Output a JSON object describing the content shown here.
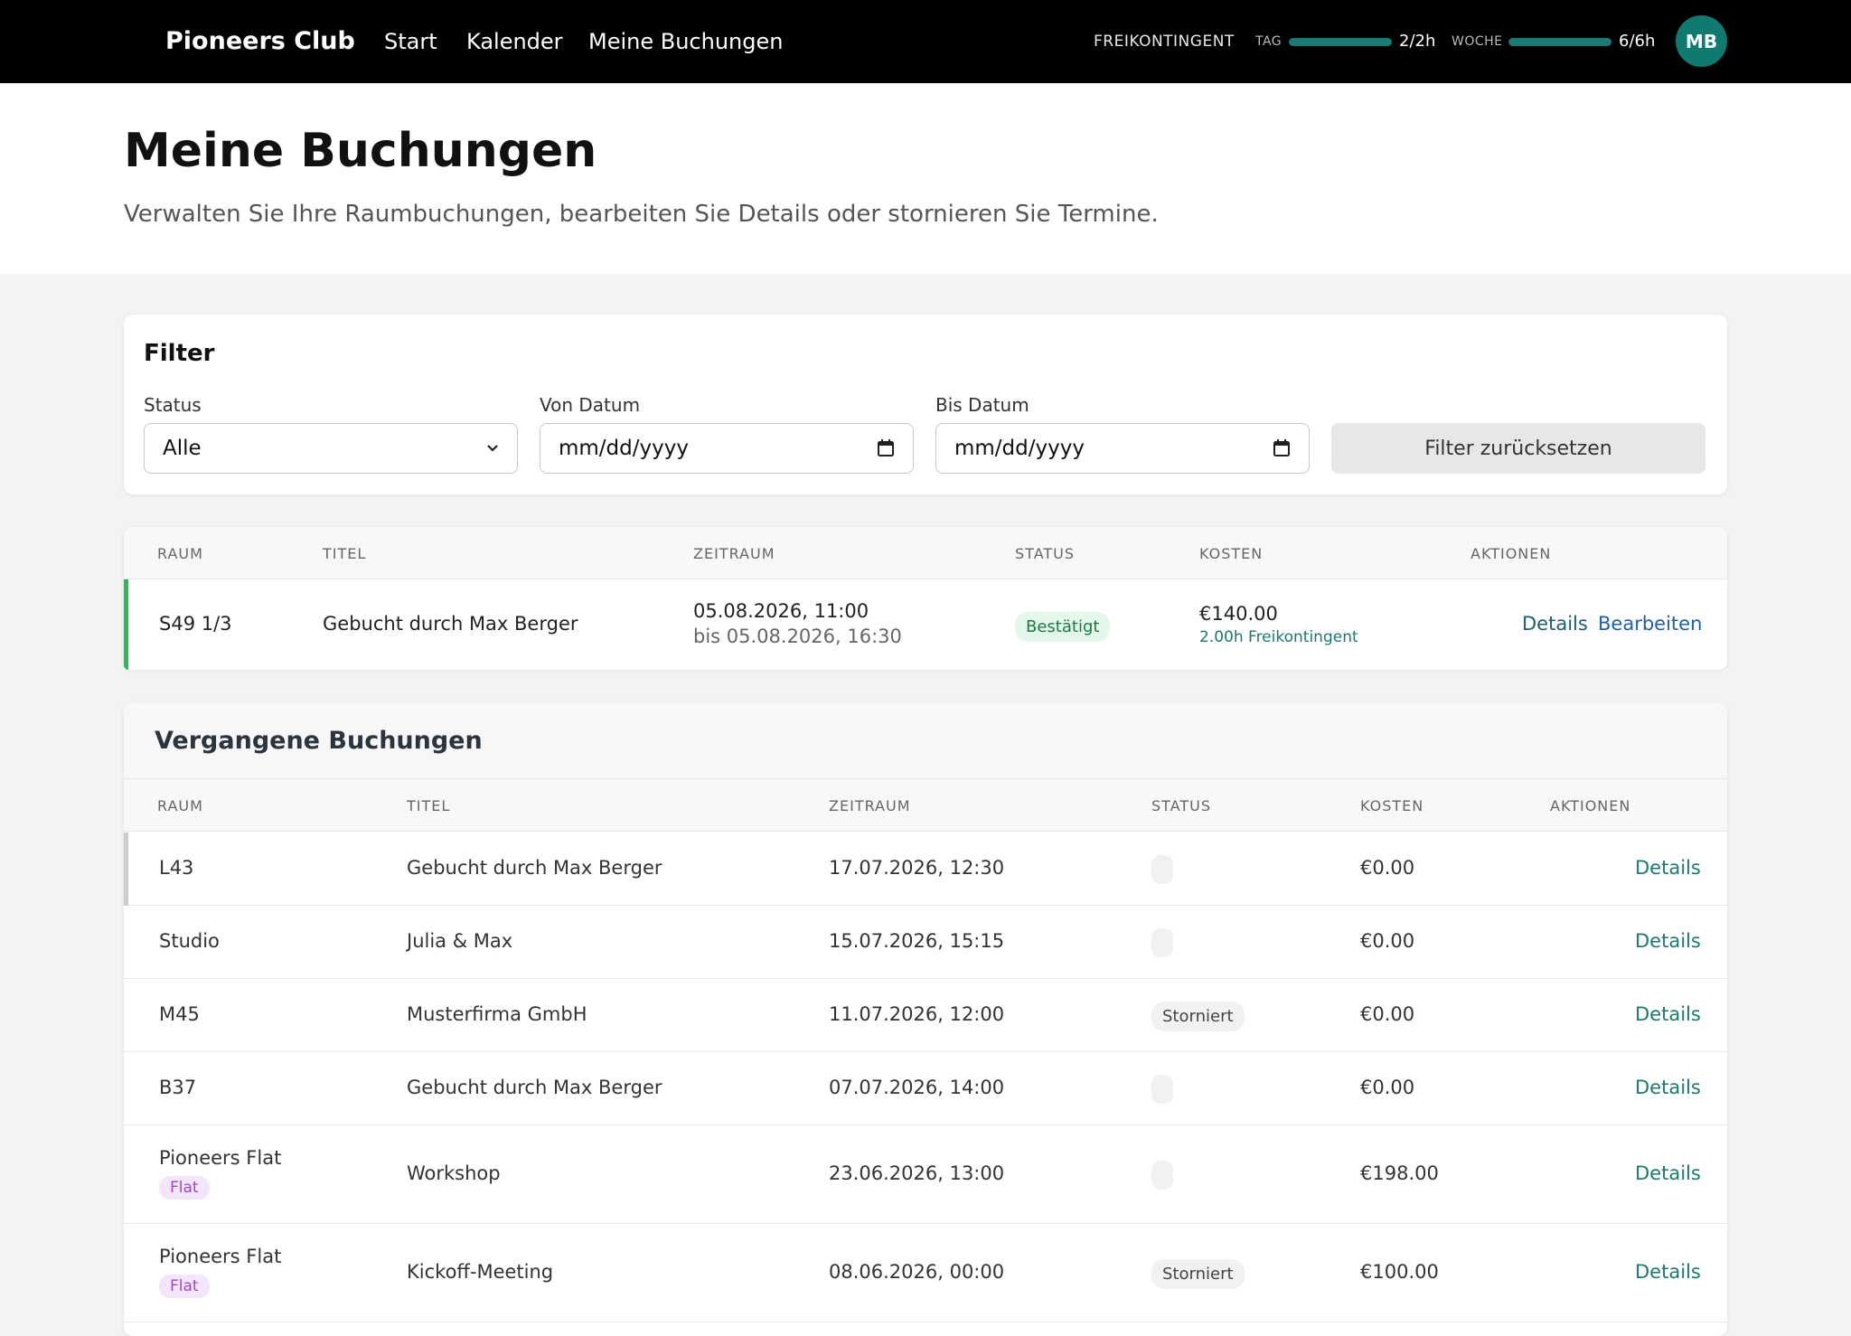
{
  "nav": {
    "brand": "Pioneers Club",
    "links": [
      "Start",
      "Kalender",
      "Meine Buchungen"
    ],
    "quota": {
      "title": "FREIKONTINGENT",
      "day_label": "TAG",
      "day_value": "2/2h",
      "day_fraction": 1.0,
      "week_label": "WOCHE",
      "week_value": "6/6h",
      "week_fraction": 1.0
    },
    "avatar": "MB"
  },
  "page": {
    "title": "Meine Buchungen",
    "subtitle": "Verwalten Sie Ihre Raumbuchungen, bearbeiten Sie Details oder stornieren Sie Termine."
  },
  "filter": {
    "title": "Filter",
    "status_label": "Status",
    "status_value": "Alle",
    "from_label": "Von Datum",
    "from_value": "mm/dd/yyyy",
    "to_label": "Bis Datum",
    "to_value": "mm/dd/yyyy",
    "reset_label": "Filter zurücksetzen"
  },
  "upcoming": {
    "headers": [
      "RAUM",
      "TITEL",
      "ZEITRAUM",
      "STATUS",
      "KOSTEN",
      "AKTIONEN"
    ],
    "rows": [
      {
        "room": "S49 1/3",
        "title": "Gebucht durch Max Berger",
        "start": "05.08.2026, 11:00",
        "end": "bis 05.08.2026, 16:30",
        "status": "Bestätigt",
        "cost": "€140.00",
        "cost_note": "2.00h Freikontingent",
        "action_details": "Details",
        "action_edit": "Bearbeiten"
      }
    ]
  },
  "past": {
    "title": "Vergangene Buchungen",
    "headers": [
      "RAUM",
      "TITEL",
      "ZEITRAUM",
      "STATUS",
      "KOSTEN",
      "AKTIONEN"
    ],
    "rows": [
      {
        "room": "L43",
        "tag": "",
        "title": "Gebucht durch Max Berger",
        "time": "17.07.2026, 12:30",
        "status": "",
        "cost": "€0.00",
        "action": "Details"
      },
      {
        "room": "Studio",
        "tag": "",
        "title": "Julia & Max",
        "time": "15.07.2026, 15:15",
        "status": "",
        "cost": "€0.00",
        "action": "Details"
      },
      {
        "room": "M45",
        "tag": "",
        "title": "Musterfirma GmbH",
        "time": "11.07.2026, 12:00",
        "status": "Storniert",
        "cost": "€0.00",
        "action": "Details"
      },
      {
        "room": "B37",
        "tag": "",
        "title": "Gebucht durch Max Berger",
        "time": "07.07.2026, 14:00",
        "status": "",
        "cost": "€0.00",
        "action": "Details"
      },
      {
        "room": "Pioneers Flat",
        "tag": "Flat",
        "title": "Workshop",
        "time": "23.06.2026, 13:00",
        "status": "",
        "cost": "€198.00",
        "action": "Details"
      },
      {
        "room": "Pioneers Flat",
        "tag": "Flat",
        "title": "Kickoff-Meeting",
        "time": "08.06.2026, 00:00",
        "status": "Storniert",
        "cost": "€100.00",
        "action": "Details"
      }
    ]
  },
  "colors": {
    "accent": "#0e7a70",
    "confirmed_bg": "#e3f7ea",
    "confirmed_text": "#1c7a43",
    "link_blue": "#1f5fae",
    "link_teal": "#1b7a6f",
    "upcoming_accent": "#2bbb55",
    "past_accent": "#c8cdd3"
  }
}
